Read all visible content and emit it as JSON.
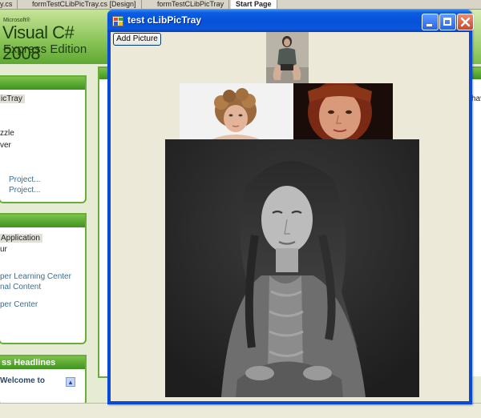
{
  "ide": {
    "tabs": [
      {
        "label": "y.cs"
      },
      {
        "label": "formTestCLibPicTray.cs [Design]"
      },
      {
        "label": "formTestCLibPicTray"
      },
      {
        "label": "Start Page",
        "active": true
      }
    ],
    "banner": {
      "microsoft": "Microsoft®",
      "product": "Visual C# 2008",
      "edition": "Express Edition"
    },
    "panels": {
      "recent_projects": {
        "lines": [
          "icTray",
          "zzle",
          "ver",
          "Project...",
          "Project..."
        ]
      },
      "getting_started": {
        "lines": [
          "Application",
          "ur",
          "per Learning Center",
          "nal Content",
          "per Center"
        ]
      },
      "headlines": {
        "title": "ss Headlines",
        "lines": [
          "Welcome to"
        ]
      }
    },
    "right_text": "hav"
  },
  "window": {
    "title": "test cLibPicTray",
    "add_button": "Add Picture",
    "pictures": [
      {
        "name": "thumbnail-seated-woman",
        "tone": "color"
      },
      {
        "name": "thumbnail-curly-blonde",
        "tone": "color"
      },
      {
        "name": "thumbnail-red-hair-portrait",
        "tone": "color"
      },
      {
        "name": "large-bw-portrait",
        "tone": "grayscale"
      }
    ]
  },
  "colors": {
    "xp_title_blue": "#0651d8",
    "client_bg": "#ece9d8",
    "vs_green": "#6aae3a",
    "close_red": "#c64b2b"
  }
}
